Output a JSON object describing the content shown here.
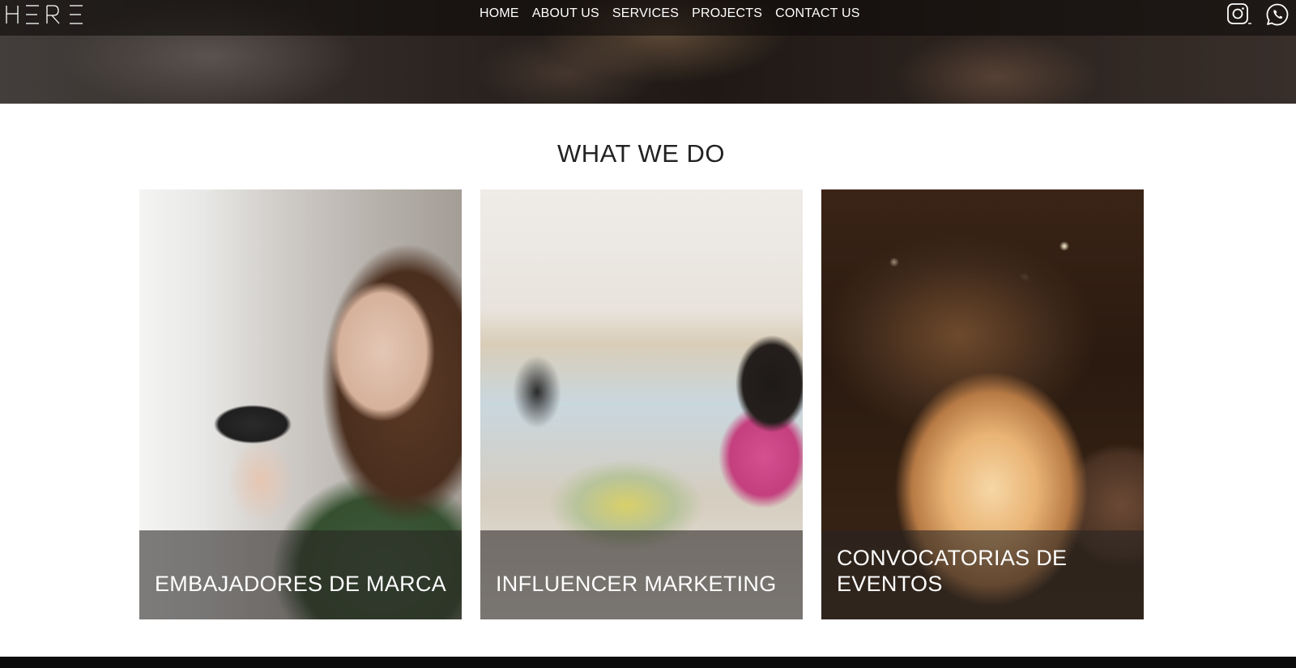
{
  "header": {
    "logo_text": "HERE",
    "nav": [
      {
        "label": "HOME"
      },
      {
        "label": "ABOUT US"
      },
      {
        "label": "SERVICES"
      },
      {
        "label": "PROJECTS"
      },
      {
        "label": "CONTACT US"
      }
    ],
    "social": [
      {
        "icon": "instagram-icon"
      },
      {
        "icon": "whatsapp-icon"
      }
    ]
  },
  "main": {
    "title": "WHAT WE DO",
    "cards": [
      {
        "caption": "EMBAJADORES DE MARCA"
      },
      {
        "caption": "INFLUENCER MARKETING"
      },
      {
        "caption": "CONVOCATORIAS DE EVENTOS"
      }
    ]
  },
  "colors": {
    "nav_text": "#ffffff",
    "title_text": "#222222",
    "caption_bar": "rgba(40,36,34,0.58)",
    "footer": "#0c0c0c"
  }
}
